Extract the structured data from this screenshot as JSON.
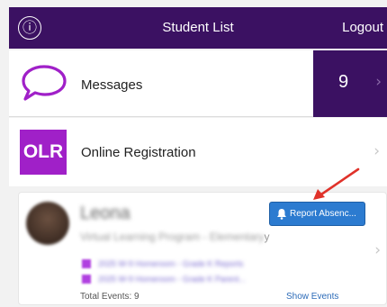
{
  "header": {
    "info_icon": "ⓘ",
    "title": "Student List",
    "logout_label": "Logout"
  },
  "messages": {
    "label": "Messages",
    "count": "9",
    "chevron": "›"
  },
  "registration": {
    "logo_text": "OLR",
    "label": "Online Registration",
    "chevron": "›"
  },
  "student": {
    "name": "Leona",
    "program": "Virtual Learning Program - Elementary",
    "program_tail": "y",
    "report_label": "Report Absenc...",
    "events": [
      {
        "text": "2025 W-9 Homeroom - Grade K Reports"
      },
      {
        "text": "2025 W-9 Homeroom - Grade K Parent..."
      }
    ],
    "total_events": "Total Events: 9",
    "show_events_label": "Show Events",
    "chevron": "›"
  },
  "colors": {
    "header_bg": "#3b1162",
    "accent_purple": "#a020c8",
    "report_button": "#2c7bd0",
    "annotation_arrow": "#e0322a"
  }
}
